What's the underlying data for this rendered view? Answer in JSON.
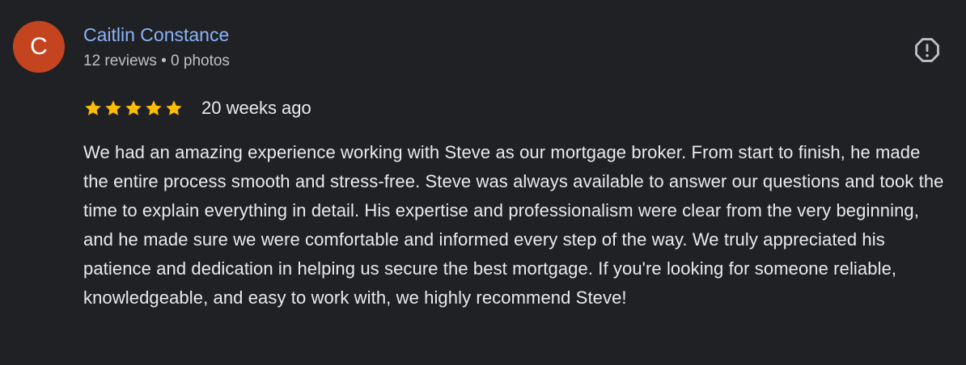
{
  "reviewer": {
    "avatar_initial": "C",
    "avatar_color": "#c4441f",
    "name": "Caitlin Constance",
    "meta": "12 reviews • 0 photos"
  },
  "report_button": {
    "icon": "report-icon"
  },
  "review": {
    "rating": 5,
    "max_rating": 5,
    "date": "20 weeks ago",
    "text": "We had an amazing experience working with Steve as our mortgage broker. From start to finish, he made the entire process smooth and stress-free. Steve was always available to answer our questions and took the time to explain everything in detail. His expertise and professionalism were clear from the very beginning, and he made sure we were comfortable and informed every step of the way. We truly appreciated his patience and dedication in helping us secure the best mortgage. If you're looking for someone reliable, knowledgeable, and easy to work with, we highly recommend Steve!"
  },
  "colors": {
    "background": "#202124",
    "name_link": "#8ab4f8",
    "star": "#fbbc04",
    "text": "#e8eaed",
    "muted": "#bdc1c6"
  }
}
